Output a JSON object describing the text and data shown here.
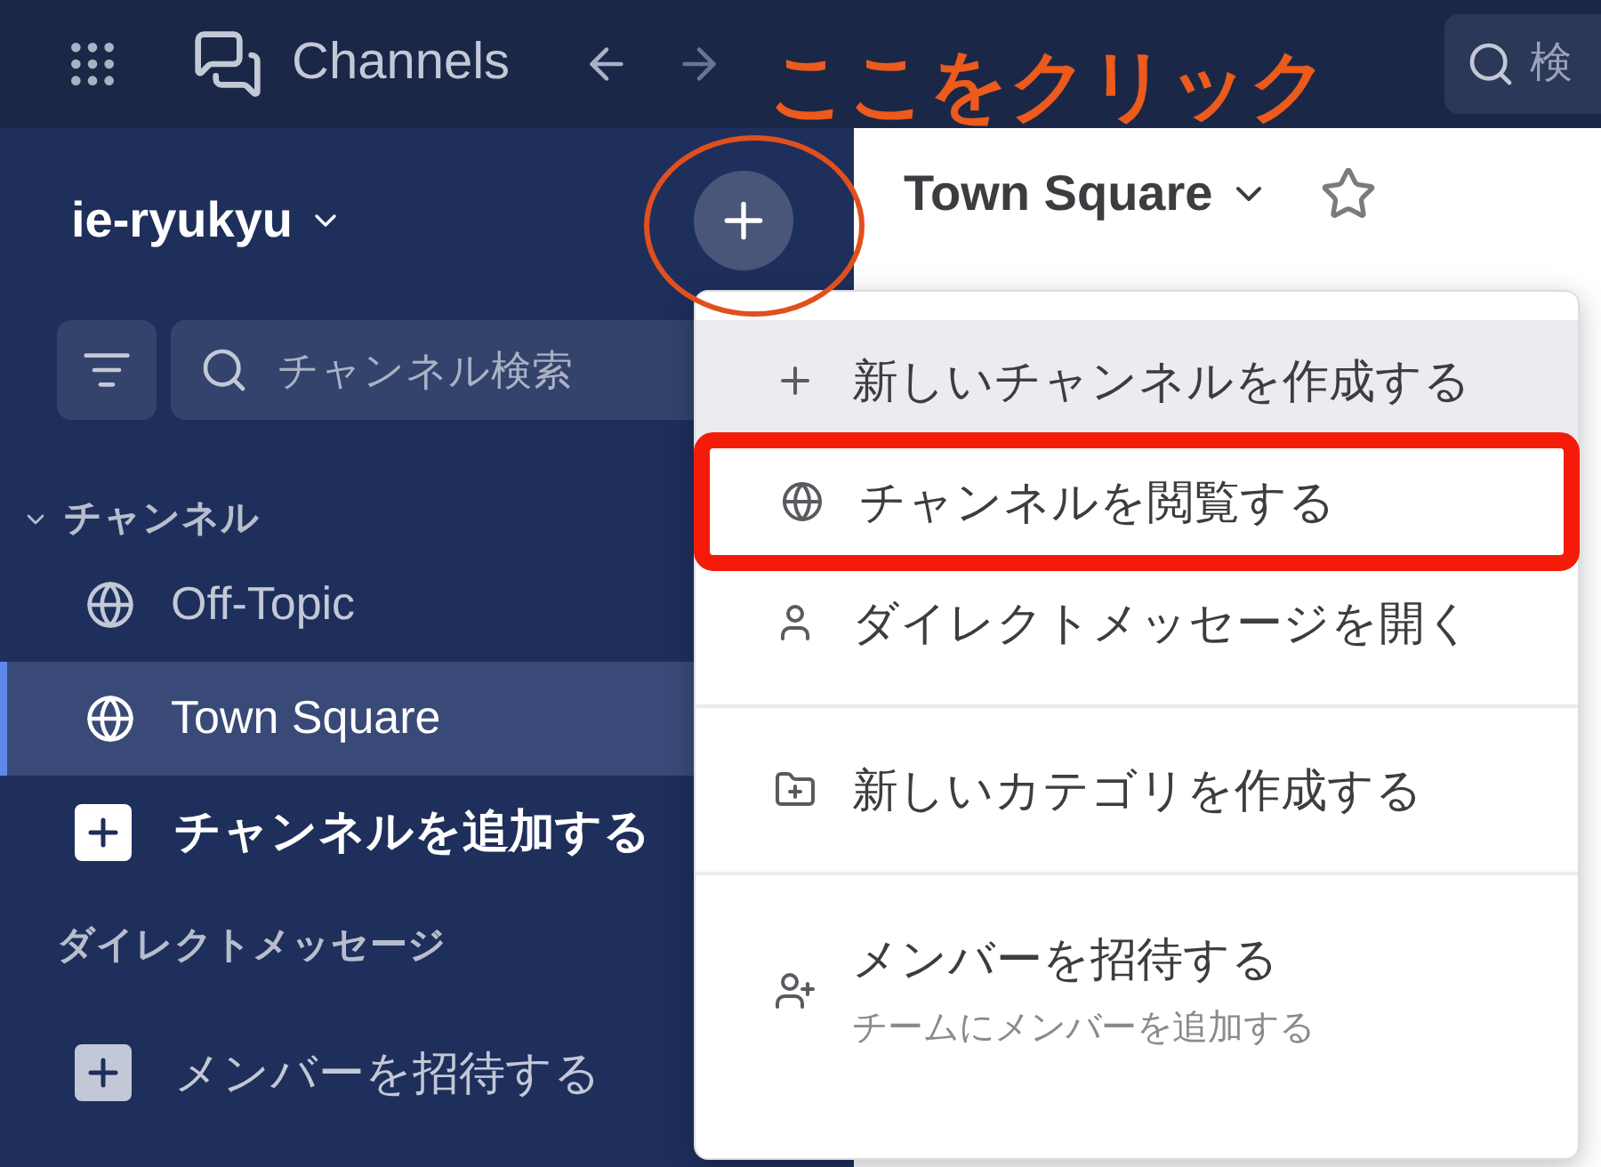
{
  "top_bar": {
    "title": "Channels",
    "search": {
      "placeholder": "検"
    }
  },
  "annotation": {
    "text": "ここをクリック"
  },
  "sidebar": {
    "team_name": "ie-ryukyu",
    "search": {
      "placeholder": "チャンネル検索"
    },
    "items": [
      {
        "kind": "section",
        "label": "チャンネル",
        "collapsible": true
      },
      {
        "kind": "channel",
        "label": "Off-Topic",
        "selected": false
      },
      {
        "kind": "channel",
        "label": "Town Square",
        "selected": true
      },
      {
        "kind": "add",
        "label": "チャンネルを追加する",
        "emphasized": true
      },
      {
        "kind": "section",
        "label": "ダイレクトメッセージ",
        "collapsible": false
      },
      {
        "kind": "add",
        "label": "メンバーを招待する",
        "emphasized": false
      }
    ]
  },
  "channel_header": {
    "title": "Town Square"
  },
  "menu": {
    "groups": [
      [
        {
          "kind": "create",
          "label": "新しいチャンネルを作成する",
          "highlighted": true,
          "annotated": false
        },
        {
          "kind": "browse",
          "label": "チャンネルを閲覧する",
          "highlighted": false,
          "annotated": true
        },
        {
          "kind": "direct",
          "label": "ダイレクトメッセージを開く",
          "highlighted": false,
          "annotated": false
        }
      ],
      [
        {
          "kind": "category",
          "label": "新しいカテゴリを作成する",
          "highlighted": false,
          "annotated": false
        }
      ],
      [
        {
          "kind": "invite",
          "label": "メンバーを招待する",
          "subtitle": "チームにメンバーを追加する",
          "highlighted": false,
          "annotated": false
        }
      ]
    ]
  }
}
